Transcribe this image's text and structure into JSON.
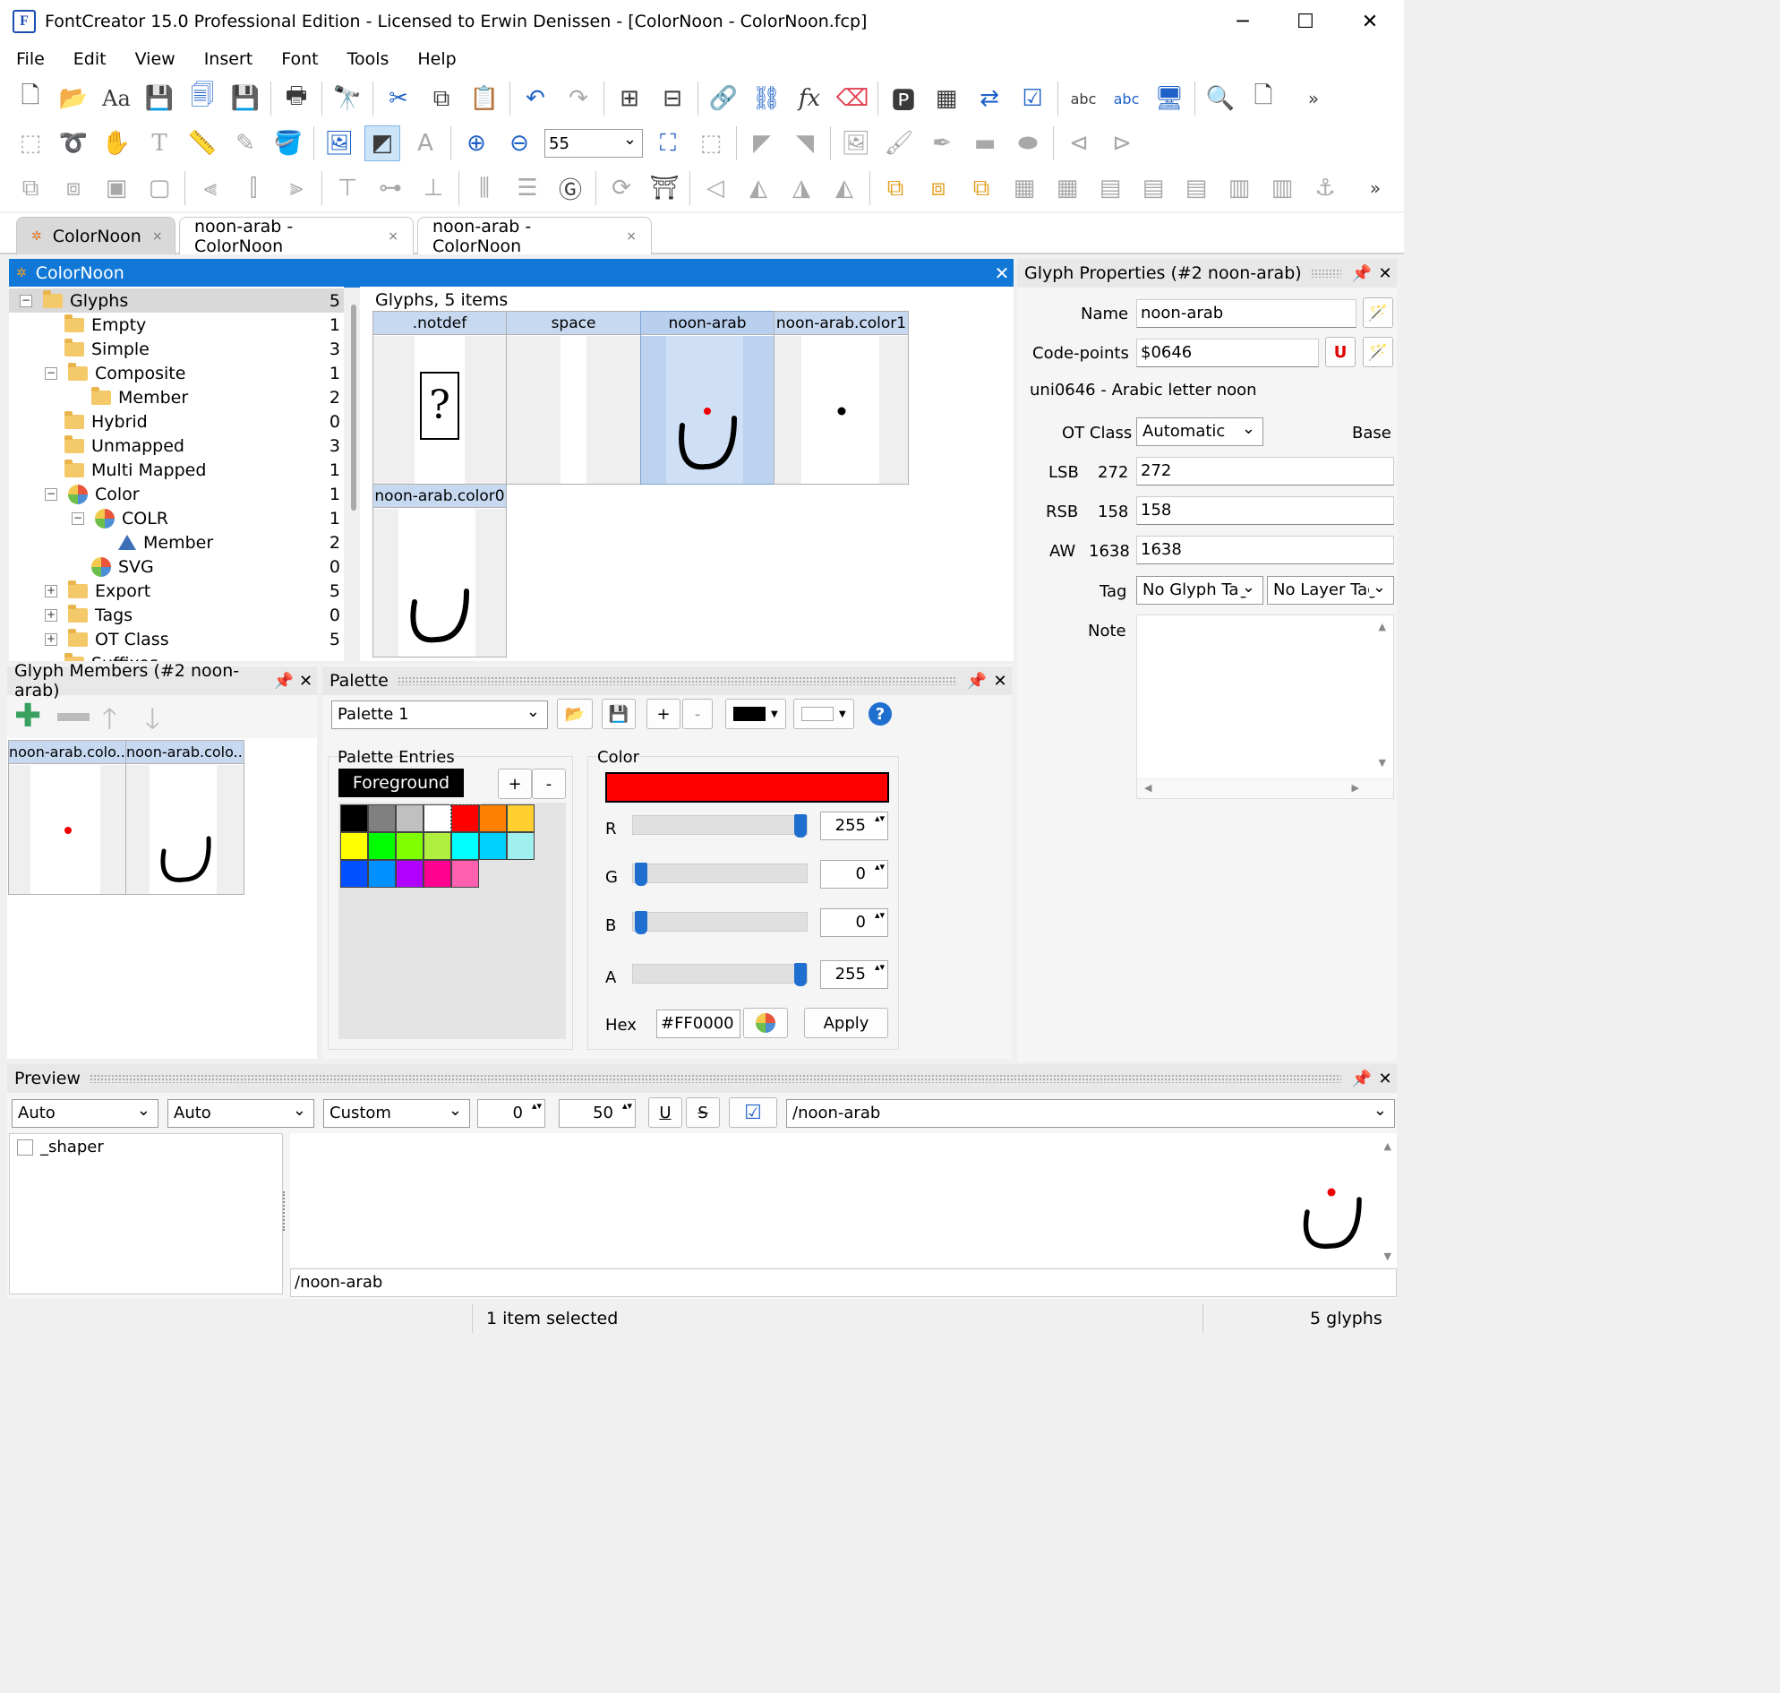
{
  "window": {
    "title": "FontCreator 15.0 Professional Edition - Licensed to Erwin Denissen - [ColorNoon - ColorNoon.fcp]",
    "app_icon": "F",
    "minimize": "─",
    "maximize": "☐",
    "close": "✕"
  },
  "menu": [
    "File",
    "Edit",
    "View",
    "Insert",
    "Font",
    "Tools",
    "Help"
  ],
  "toolbar": {
    "zoom_value": "55",
    "overflow": "»"
  },
  "tabs": [
    {
      "label": "ColorNoon",
      "close": "×"
    },
    {
      "label": "noon-arab - ColorNoon",
      "close": "×"
    },
    {
      "label": "noon-arab - ColorNoon",
      "close": "×"
    }
  ],
  "overview": {
    "title": "ColorNoon",
    "close": "✕",
    "tree": [
      {
        "label": "Glyphs",
        "count": "5",
        "expander": "−"
      },
      {
        "label": "Empty",
        "count": "1"
      },
      {
        "label": "Simple",
        "count": "3"
      },
      {
        "label": "Composite",
        "count": "1",
        "expander": "−"
      },
      {
        "label": "Member",
        "count": "2"
      },
      {
        "label": "Hybrid",
        "count": "0"
      },
      {
        "label": "Unmapped",
        "count": "3"
      },
      {
        "label": "Multi Mapped",
        "count": "1"
      },
      {
        "label": "Color",
        "count": "1",
        "expander": "−"
      },
      {
        "label": "COLR",
        "count": "1",
        "expander": "−"
      },
      {
        "label": "Member",
        "count": "2"
      },
      {
        "label": "SVG",
        "count": "0"
      },
      {
        "label": "Export",
        "count": "5",
        "expander": "+"
      },
      {
        "label": "Tags",
        "count": "0",
        "expander": "+"
      },
      {
        "label": "OT Class",
        "count": "5",
        "expander": "+"
      },
      {
        "label": "Suffixes",
        "count": ""
      }
    ],
    "glyphs_header": "Glyphs, 5 items",
    "glyphs": [
      ".notdef",
      "space",
      "noon-arab",
      "noon-arab.color1",
      "noon-arab.color0"
    ],
    "notdef_char": "?"
  },
  "properties": {
    "title": "Glyph Properties (#2 noon-arab)",
    "name_label": "Name",
    "name_value": "noon-arab",
    "codepoints_label": "Code-points",
    "codepoints_value": "$0646",
    "unicode_badge": "U",
    "description": "uni0646 - Arabic letter noon",
    "otclass_label": "OT Class",
    "otclass_value": "Automatic",
    "otclass_base": "Base",
    "lsb_label": "LSB",
    "lsb_current": "272",
    "lsb_value": "272",
    "rsb_label": "RSB",
    "rsb_current": "158",
    "rsb_value": "158",
    "aw_label": "AW",
    "aw_current": "1638",
    "aw_value": "1638",
    "tag_label": "Tag",
    "glyph_tag": "No Glyph Tag",
    "layer_tag": "No Layer Tag",
    "note_label": "Note"
  },
  "members": {
    "title": "Glyph Members (#2 noon-arab)",
    "items": [
      "noon-arab.colo...",
      "noon-arab.colo..."
    ]
  },
  "palette": {
    "title": "Palette",
    "selected": "Palette 1",
    "plus": "+",
    "minus": "-",
    "help": "?",
    "entries_label": "Palette Entries",
    "foreground": "Foreground",
    "swatches": [
      "#000000",
      "#808080",
      "#c0c0c0",
      "#ffffff",
      "#ff0000",
      "#ff8000",
      "#ffd030",
      "#ffff00",
      "#00ff00",
      "#80ff00",
      "#b0ef40",
      "#00ffff",
      "#00d0ff",
      "#a0f0f0",
      "#0050ff",
      "#0090ff",
      "#b000ff",
      "#ff0090",
      "#ff60b0"
    ],
    "color_label": "Color",
    "current_color": "#FF0000",
    "r_label": "R",
    "r_value": "255",
    "r_level": 1.0,
    "g_label": "G",
    "g_value": "0",
    "g_level": 0.0,
    "b_label": "B",
    "b_value": "0",
    "b_level": 0.0,
    "a_label": "A",
    "a_value": "255",
    "a_level": 1.0,
    "hex_label": "Hex",
    "hex_value": "#FF0000",
    "apply": "Apply"
  },
  "preview": {
    "title": "Preview",
    "dd1": "Auto",
    "dd2": "Auto",
    "dd3": "Custom",
    "spin1": "0",
    "spin2": "50",
    "underline": "U",
    "strike": "S",
    "text": "/noon-arab",
    "shaper_label": "_shaper",
    "bottom_text": "/noon-arab"
  },
  "status": {
    "selection": "1 item selected",
    "count": "5 glyphs"
  }
}
